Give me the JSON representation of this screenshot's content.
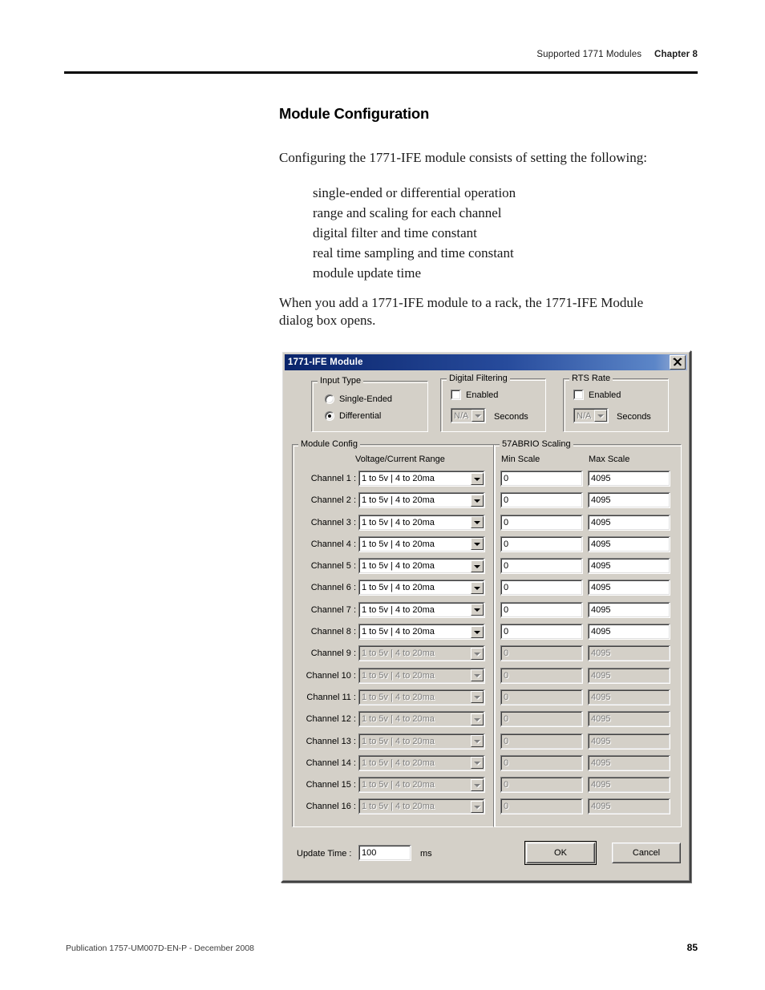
{
  "document": {
    "header_title": "Supported 1771 Modules",
    "header_chapter": "Chapter 8",
    "section_title": "Module Configuration",
    "intro": "Configuring the 1771-IFE module consists of setting the following:",
    "bullets": [
      "single-ended or differential operation",
      "range and scaling for each channel",
      "digital filter and time constant",
      "real time sampling and time constant",
      "module update time"
    ],
    "outro": "When you add a 1771-IFE module to a rack, the 1771-IFE Module dialog box opens.",
    "footer_publication": "Publication 1757-UM007D-EN-P - December 2008",
    "footer_page": "85"
  },
  "dialog": {
    "title": "1771-IFE Module",
    "close_icon": "close-icon",
    "input_type": {
      "legend": "Input Type",
      "options": [
        {
          "label": "Single-Ended",
          "selected": false
        },
        {
          "label": "Differential",
          "selected": true
        }
      ]
    },
    "digital_filtering": {
      "legend": "Digital Filtering",
      "enabled_label": "Enabled",
      "enabled_checked": false,
      "value": "N/A",
      "unit_label": "Seconds",
      "disabled": true
    },
    "rts_rate": {
      "legend": "RTS Rate",
      "enabled_label": "Enabled",
      "enabled_checked": false,
      "value": "N/A",
      "unit_label": "Seconds",
      "disabled": true
    },
    "module_config": {
      "legend": "Module Config",
      "range_header": "Voltage/Current Range",
      "channels": [
        {
          "label": "Channel 1 :",
          "range": "1 to 5v | 4 to 20ma",
          "disabled": false
        },
        {
          "label": "Channel 2 :",
          "range": "1 to 5v | 4 to 20ma",
          "disabled": false
        },
        {
          "label": "Channel 3 :",
          "range": "1 to 5v | 4 to 20ma",
          "disabled": false
        },
        {
          "label": "Channel 4 :",
          "range": "1 to 5v | 4 to 20ma",
          "disabled": false
        },
        {
          "label": "Channel 5 :",
          "range": "1 to 5v | 4 to 20ma",
          "disabled": false
        },
        {
          "label": "Channel 6 :",
          "range": "1 to 5v | 4 to 20ma",
          "disabled": false
        },
        {
          "label": "Channel 7 :",
          "range": "1 to 5v | 4 to 20ma",
          "disabled": false
        },
        {
          "label": "Channel 8 :",
          "range": "1 to 5v | 4 to 20ma",
          "disabled": false
        },
        {
          "label": "Channel 9 :",
          "range": "1 to 5v | 4 to 20ma",
          "disabled": true
        },
        {
          "label": "Channel 10 :",
          "range": "1 to 5v | 4 to 20ma",
          "disabled": true
        },
        {
          "label": "Channel 11 :",
          "range": "1 to 5v | 4 to 20ma",
          "disabled": true
        },
        {
          "label": "Channel 12 :",
          "range": "1 to 5v | 4 to 20ma",
          "disabled": true
        },
        {
          "label": "Channel 13 :",
          "range": "1 to 5v | 4 to 20ma",
          "disabled": true
        },
        {
          "label": "Channel 14 :",
          "range": "1 to 5v | 4 to 20ma",
          "disabled": true
        },
        {
          "label": "Channel 15 :",
          "range": "1 to 5v | 4 to 20ma",
          "disabled": true
        },
        {
          "label": "Channel 16 :",
          "range": "1 to 5v | 4 to 20ma",
          "disabled": true
        }
      ]
    },
    "scaling": {
      "legend": "57ABRIO Scaling",
      "min_header": "Min Scale",
      "max_header": "Max Scale",
      "rows": [
        {
          "min": "0",
          "max": "4095",
          "disabled": false
        },
        {
          "min": "0",
          "max": "4095",
          "disabled": false
        },
        {
          "min": "0",
          "max": "4095",
          "disabled": false
        },
        {
          "min": "0",
          "max": "4095",
          "disabled": false
        },
        {
          "min": "0",
          "max": "4095",
          "disabled": false
        },
        {
          "min": "0",
          "max": "4095",
          "disabled": false
        },
        {
          "min": "0",
          "max": "4095",
          "disabled": false
        },
        {
          "min": "0",
          "max": "4095",
          "disabled": false
        },
        {
          "min": "0",
          "max": "4095",
          "disabled": true
        },
        {
          "min": "0",
          "max": "4095",
          "disabled": true
        },
        {
          "min": "0",
          "max": "4095",
          "disabled": true
        },
        {
          "min": "0",
          "max": "4095",
          "disabled": true
        },
        {
          "min": "0",
          "max": "4095",
          "disabled": true
        },
        {
          "min": "0",
          "max": "4095",
          "disabled": true
        },
        {
          "min": "0",
          "max": "4095",
          "disabled": true
        },
        {
          "min": "0",
          "max": "4095",
          "disabled": true
        }
      ]
    },
    "update_time": {
      "label": "Update Time :",
      "value": "100",
      "unit": "ms"
    },
    "buttons": {
      "ok": "OK",
      "cancel": "Cancel"
    },
    "colors": {
      "face": "#d4d0c8",
      "title_start": "#0a246a",
      "title_end": "#a6b7d8",
      "disabled_text": "#808080"
    }
  }
}
